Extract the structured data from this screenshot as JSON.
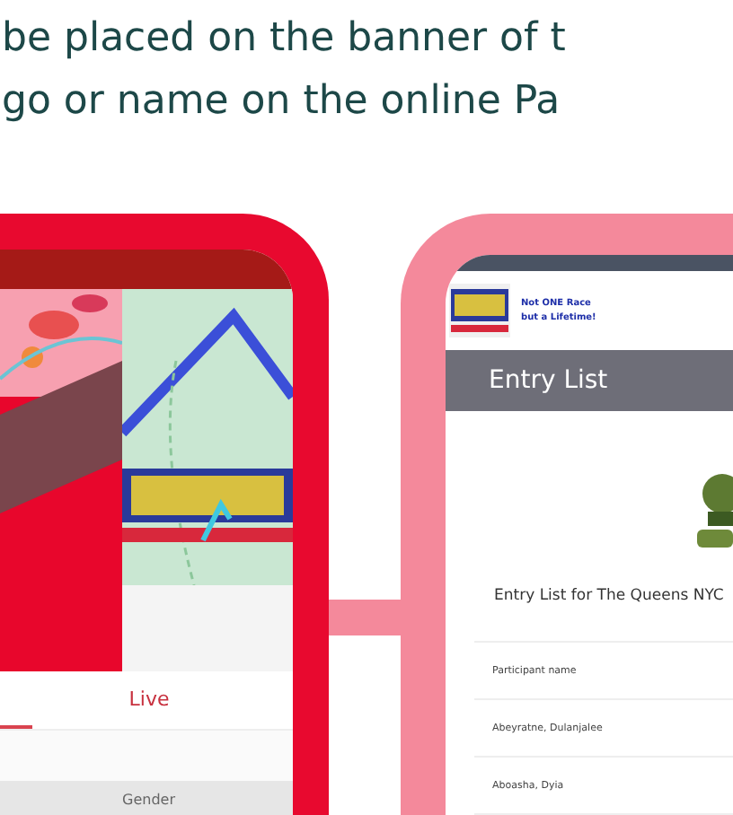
{
  "intro_lines": [
    "be placed on the banner of t",
    "go or name on the online Pa"
  ],
  "left_phone": {
    "tabs": [
      {
        "selected": true
      },
      {
        "label": "Live",
        "selected": false
      }
    ],
    "column_header": "Gender"
  },
  "right_phone": {
    "tagline": [
      "Not ONE Race",
      "but a Lifetime!"
    ],
    "page_title": "Entry List",
    "caption": "Entry List  for The Queens NYC",
    "table": {
      "header": "Participant name",
      "rows": [
        "Abeyratne, Dulanjalee",
        "Aboasha, Dyia"
      ]
    }
  }
}
